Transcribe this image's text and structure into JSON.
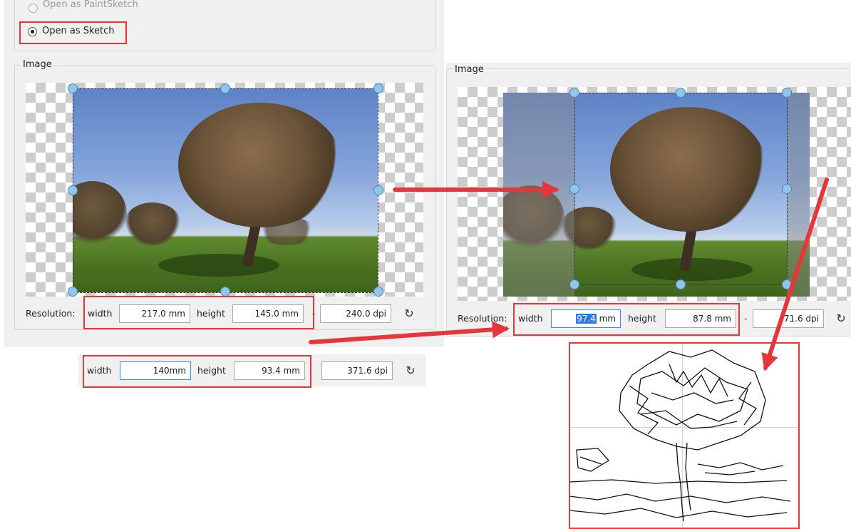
{
  "top_panel": {
    "option_faded_label": "Open as PaintSketch",
    "option_selected_label": "Open as Sketch"
  },
  "left_image": {
    "group_title": "Image",
    "resolution_label": "Resolution:",
    "width_label": "width",
    "width_value": "217.0 mm",
    "height_label": "height",
    "height_value": "145.0 mm",
    "dash": "-",
    "dpi_value": "240.0 dpi"
  },
  "lower_row": {
    "width_label": "width",
    "width_value": "140mm",
    "height_label": "height",
    "height_value": "93.4 mm",
    "dpi_value": "371.6 dpi"
  },
  "right_image": {
    "group_title": "Image",
    "resolution_label": "Resolution:",
    "width_label": "width",
    "width_selected_text": "97.4",
    "width_unit": " mm",
    "height_label": "height",
    "height_value": "87.8 mm",
    "dash": "-",
    "dpi_value": "71.6 dpi"
  },
  "icons": {
    "reset": "reset-rotate-icon",
    "arrow": "red-arrow-icon"
  },
  "colors": {
    "highlight_red": "#e5363c",
    "handle_blue": "#8fc6ea",
    "focus_blue": "#3c8ee8"
  }
}
